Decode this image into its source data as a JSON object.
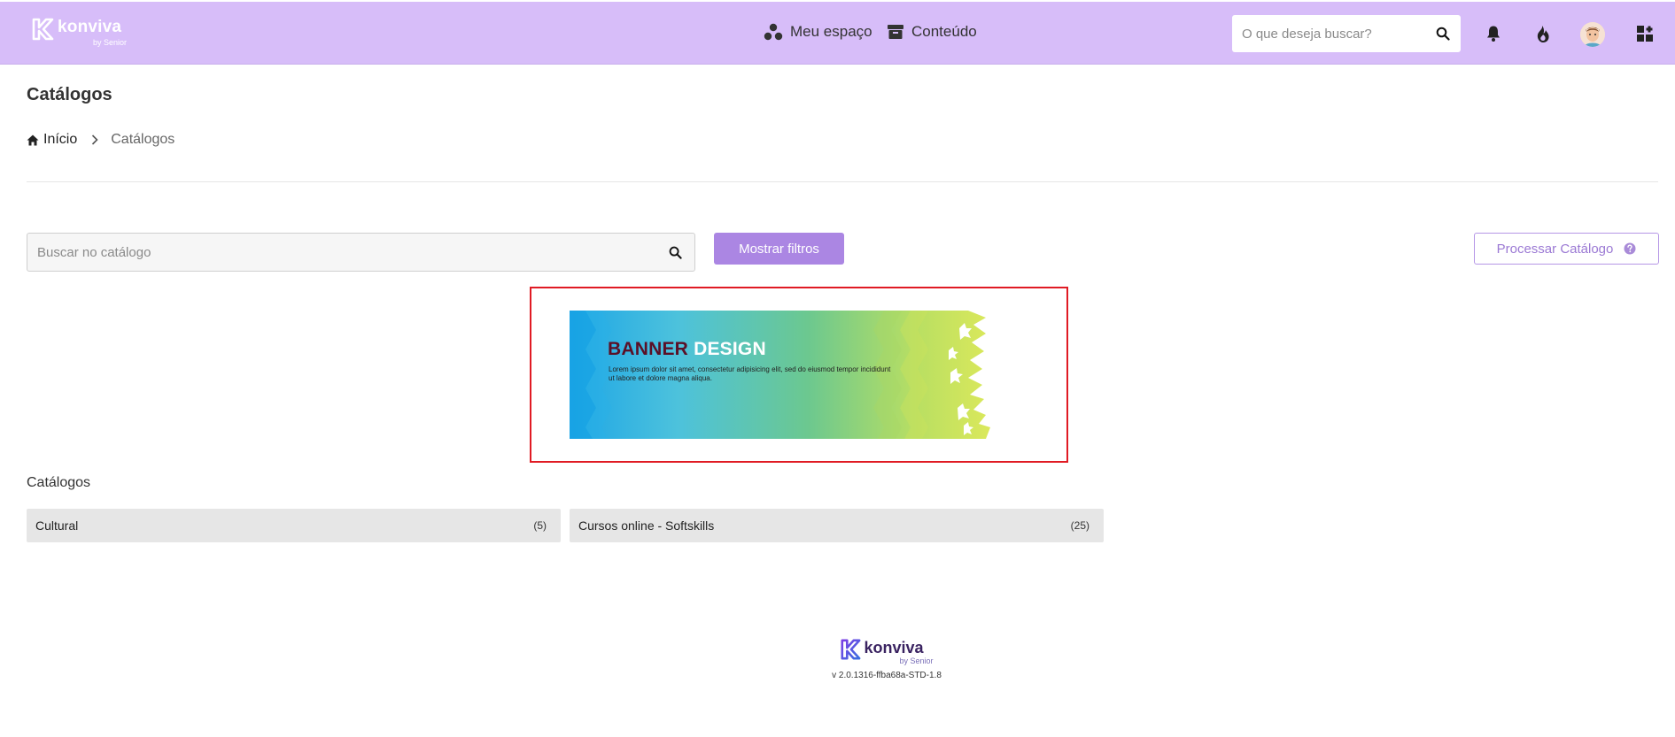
{
  "header": {
    "logo_text": "konviva",
    "logo_by": "by Senior",
    "nav": [
      {
        "label": "Meu espaço",
        "icon": "users-circle-icon"
      },
      {
        "label": "Conteúdo",
        "icon": "archive-box-icon"
      }
    ],
    "search_placeholder": "O que deseja buscar?",
    "icons": [
      "bell-icon",
      "fire-icon",
      "avatar",
      "apps-icon"
    ],
    "bg_color": "#d7bdf9"
  },
  "page": {
    "title": "Catálogos",
    "breadcrumb": {
      "home": "Início",
      "current": "Catálogos"
    }
  },
  "toolbar": {
    "search_placeholder": "Buscar no catálogo",
    "filters_label": "Mostrar filtros",
    "process_label": "Processar Catálogo",
    "accent": "#ab86e3"
  },
  "banner": {
    "title_part1": "BANNER",
    "title_part2": "DESIGN",
    "text": "Lorem ipsum dolor sit amet, consectetur adipisicing elit, sed do eiusmod tempor incididunt ut labore et dolore magna aliqua.",
    "highlight_color": "#e01b24"
  },
  "catalogs": {
    "label": "Catálogos",
    "items": [
      {
        "name": "Cultural",
        "count": "(5)"
      },
      {
        "name": "Cursos online - Softskills",
        "count": "(25)"
      }
    ]
  },
  "footer": {
    "logo_text": "konviva",
    "logo_by": "by Senior",
    "version": "v 2.0.1316-ffba68a-STD-1.8"
  }
}
